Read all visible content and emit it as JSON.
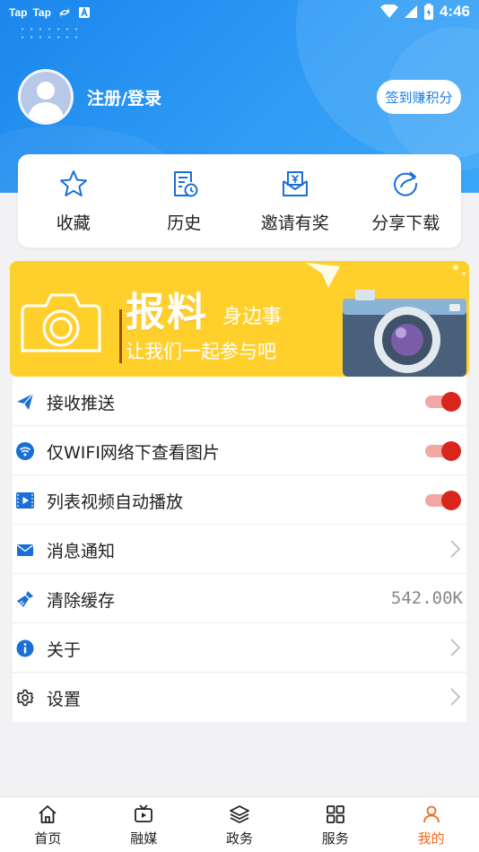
{
  "status_bar": {
    "left_labels": [
      "Tap",
      "Tap"
    ],
    "time": "4:46"
  },
  "profile": {
    "login_label": "注册/登录",
    "checkin_label": "签到赚积分"
  },
  "quick_actions": [
    {
      "label": "收藏",
      "icon": "star-icon"
    },
    {
      "label": "历史",
      "icon": "history-icon"
    },
    {
      "label": "邀请有奖",
      "icon": "invite-icon"
    },
    {
      "label": "分享下载",
      "icon": "share-icon"
    }
  ],
  "banner": {
    "title": "报料",
    "subtitle_1": "身边事",
    "subtitle_2": "让我们一起参与吧",
    "color": "#ffd02c"
  },
  "settings": [
    {
      "label": "接收推送",
      "icon": "paper-plane-icon",
      "control": "toggle",
      "on": true
    },
    {
      "label": "仅WIFI网络下查看图片",
      "icon": "wifi-icon",
      "control": "toggle",
      "on": true
    },
    {
      "label": "列表视频自动播放",
      "icon": "video-icon",
      "control": "toggle",
      "on": true
    },
    {
      "label": "消息通知",
      "icon": "mail-icon",
      "control": "chevron"
    },
    {
      "label": "清除缓存",
      "icon": "broom-icon",
      "control": "value",
      "value": "542.00K"
    },
    {
      "label": "关于",
      "icon": "info-icon",
      "control": "chevron"
    },
    {
      "label": "设置",
      "icon": "gear-icon",
      "control": "chevron"
    }
  ],
  "tabs": [
    {
      "label": "首页",
      "icon": "home-icon",
      "active": false
    },
    {
      "label": "融媒",
      "icon": "tv-icon",
      "active": false
    },
    {
      "label": "政务",
      "icon": "layers-icon",
      "active": false
    },
    {
      "label": "服务",
      "icon": "grid-icon",
      "active": false
    },
    {
      "label": "我的",
      "icon": "user-icon",
      "active": true
    }
  ],
  "colors": {
    "header_blue": "#1b86ec",
    "icon_blue": "#1a6fd6",
    "toggle_on": "#d9261c",
    "active_tab": "#f06a1d"
  }
}
